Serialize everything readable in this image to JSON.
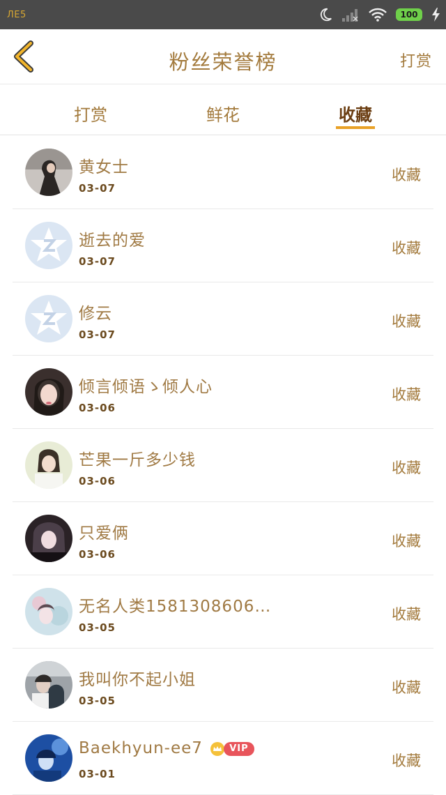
{
  "status": {
    "left_text": "ЛЕ5"
  },
  "header": {
    "title": "粉丝荣誉榜",
    "action_label": "打赏"
  },
  "tabs": [
    {
      "label": "打赏",
      "active": false
    },
    {
      "label": "鲜花",
      "active": false
    },
    {
      "label": "收藏",
      "active": true
    }
  ],
  "colors": {
    "accent": "#e9a126",
    "text_brown": "#a37a3c",
    "dark_brown": "#6b3e12",
    "vip_red": "#e8545b"
  },
  "list": [
    {
      "name": "黄女士",
      "date": "03-07",
      "action": "收藏",
      "avatar": "photo-dark"
    },
    {
      "name": "逝去的爱",
      "date": "03-07",
      "action": "收藏",
      "avatar": "default-star"
    },
    {
      "name": "修云",
      "date": "03-07",
      "action": "收藏",
      "avatar": "default-star"
    },
    {
      "name": "倾言倾语ゝ倾人心",
      "date": "03-06",
      "action": "收藏",
      "avatar": "photo-girl"
    },
    {
      "name": "芒果一斤多少钱",
      "date": "03-06",
      "action": "收藏",
      "avatar": "photo-light"
    },
    {
      "name": "只爱俩",
      "date": "03-06",
      "action": "收藏",
      "avatar": "photo-girl2"
    },
    {
      "name": "无名人类1581308606…",
      "date": "03-05",
      "action": "收藏",
      "avatar": "photo-pastel"
    },
    {
      "name": "我叫你不起小姐",
      "date": "03-05",
      "action": "收藏",
      "avatar": "photo-couple"
    },
    {
      "name": "Baekhyun-ee7",
      "date": "03-01",
      "action": "收藏",
      "avatar": "photo-blue",
      "vip": "VIP"
    }
  ]
}
